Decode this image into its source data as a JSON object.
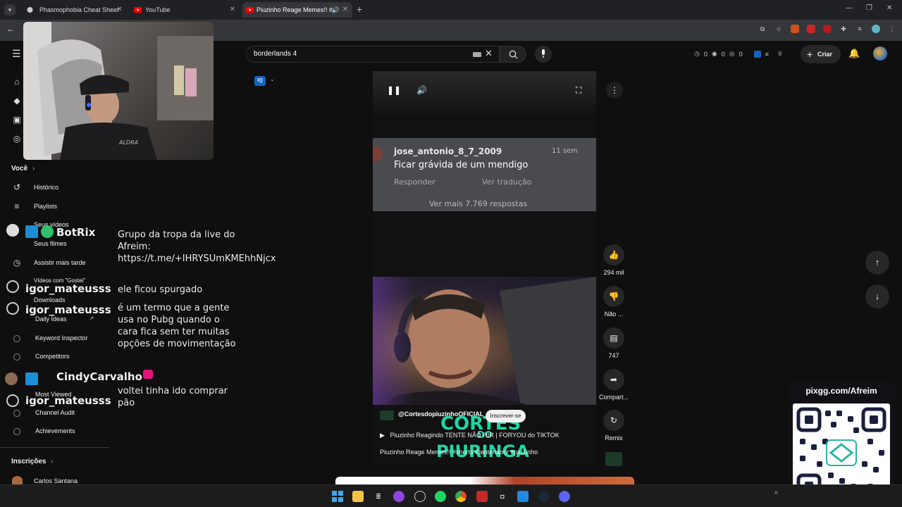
{
  "browser": {
    "tabs": [
      {
        "title": "Phasmophobia Cheat Sheet"
      },
      {
        "title": "YouTube"
      },
      {
        "title": "Piuzinho Reage Memes!! #..."
      }
    ],
    "new_tab": "+",
    "tab_close": "✕"
  },
  "header": {
    "search_value": "borderlands 4",
    "counters": [
      "0",
      "0",
      "0"
    ],
    "create_label": "Criar"
  },
  "sidebar": {
    "you_label": "Você",
    "items": [
      {
        "label": "Histórico"
      },
      {
        "label": "Playlists"
      },
      {
        "label": "Seus vídeos"
      },
      {
        "label": "Seus filmes"
      },
      {
        "label": "Assistir mais tarde"
      },
      {
        "label": "Vídeos com \"Gostei\""
      },
      {
        "label": "Downloads"
      },
      {
        "label": "Daily Ideas"
      },
      {
        "label": "Keyword Inspector"
      },
      {
        "label": "Competitors"
      },
      {
        "label": "Most Viewed"
      },
      {
        "label": "Channel Audit"
      },
      {
        "label": "Achievements"
      }
    ],
    "subscriptions_label": "Inscrições",
    "channel_first": "Carlos Santana"
  },
  "chat": {
    "messages": [
      {
        "user": "BotRix",
        "text": "Grupo da tropa da live do Afreim: https://t.me/+IHRYSUmKMEhhNjcx"
      },
      {
        "user": "igor_mateusss",
        "text": "ele ficou spurgado"
      },
      {
        "user": "igor_mateusss",
        "text": "é um termo que a gente usa no Pubg quando o cara fica sem ter muitas opções de movimentação"
      },
      {
        "user": "CindyCarvalho",
        "text": ""
      },
      {
        "user": "igor_mateusss",
        "text": "voltei tinha ido comprar pão"
      }
    ]
  },
  "short": {
    "comment_user": "jose_antonio_8_7_2009",
    "comment_time": "11 sem",
    "comment_text": "Ficar grávida de um mendigo",
    "reply": "Responder",
    "translate": "Ver tradução",
    "more_replies": "Ver mais 7.769 respostas",
    "channel": "@CortesdopiuzinhoOFICIAL",
    "subscribe": "Inscrever-se",
    "sound": "Piuzinho Reagindo TENTE NÃO RIR | FORYOU do TIKTOK",
    "description": "Piuzinho Reage Memes!! #shorts #tentenaorir #piuzinho",
    "overlay_line1": "CORTES",
    "overlay_line2": "DO",
    "overlay_line3": "PIURINGA",
    "actions": {
      "likes": "294 mil",
      "dislike": "Não ...",
      "comments": "747",
      "share": "Compart...",
      "remix": "Remix"
    }
  },
  "overlay": {
    "qr_url": "pixgg.com/Afreim"
  },
  "colors": {
    "youtube_red": "#ff0000",
    "accent_teal": "#1cd8a6",
    "iq_blue": "#1565c0"
  }
}
